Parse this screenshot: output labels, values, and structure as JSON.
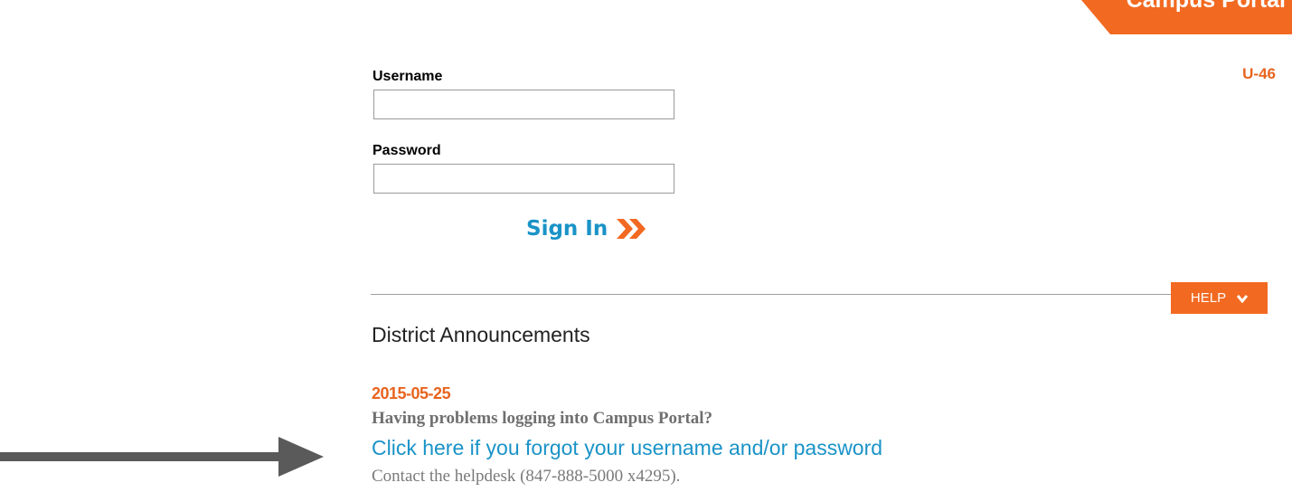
{
  "header": {
    "portal_tab_label": "Campus Portal",
    "app_id": "U-46"
  },
  "login": {
    "username_label": "Username",
    "username_value": "",
    "password_label": "Password",
    "password_value": "",
    "sign_in_label": "Sign In",
    "sign_in_icon": "double-chevron-right-icon"
  },
  "help": {
    "label": "HELP",
    "icon": "chevron-down-icon"
  },
  "announcements": {
    "heading": "District Announcements",
    "items": [
      {
        "date": "2015-05-25",
        "title": "Having problems logging into Campus Portal?",
        "link_text": "Click here if you forgot your username and/or password",
        "contact": "Contact the helpdesk (847-888-5000 x4295)."
      }
    ]
  },
  "annotation": {
    "arrow_icon": "arrow-right-icon"
  },
  "colors": {
    "accent_orange": "#f26a21",
    "link_blue": "#1a93c7",
    "date_orange": "#e8641e"
  }
}
